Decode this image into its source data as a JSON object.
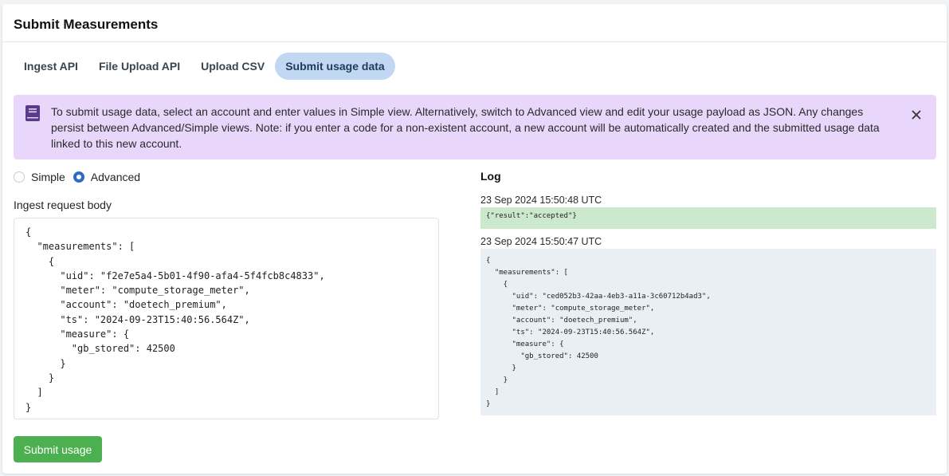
{
  "page": {
    "title": "Submit Measurements"
  },
  "tabs": [
    {
      "label": "Ingest API",
      "active": false
    },
    {
      "label": "File Upload API",
      "active": false
    },
    {
      "label": "Upload CSV",
      "active": false
    },
    {
      "label": "Submit usage data",
      "active": true
    }
  ],
  "banner": {
    "icon": "book-icon",
    "text": "To submit usage data, select an account and enter values in Simple view. Alternatively, switch to Advanced view and edit your usage payload as JSON. Any changes persist between Advanced/Simple views. Note: if you enter a code for a non-existent account, a new account will be automatically created and the submitted usage data linked to this new account.",
    "color": "#e8d7fb"
  },
  "view_toggle": {
    "options": [
      {
        "label": "Simple",
        "checked": false
      },
      {
        "label": "Advanced",
        "checked": true
      }
    ]
  },
  "editor": {
    "label": "Ingest request body",
    "content": "{\n  \"measurements\": [\n    {\n      \"uid\": \"f2e7e5a4-5b01-4f90-afa4-5f4fcb8c4833\",\n      \"meter\": \"compute_storage_meter\",\n      \"account\": \"doetech_premium\",\n      \"ts\": \"2024-09-23T15:40:56.564Z\",\n      \"measure\": {\n        \"gb_stored\": 42500\n      }\n    }\n  ]\n}"
  },
  "log": {
    "title": "Log",
    "entries": [
      {
        "timestamp": "23 Sep 2024 15:50:48 UTC",
        "content": "{\"result\":\"accepted\"}",
        "status_color": "#cde9cd"
      },
      {
        "timestamp": "23 Sep 2024 15:50:47 UTC",
        "content": "{\n  \"measurements\": [\n    {\n      \"uid\": \"ced052b3-42aa-4eb3-a11a-3c60712b4ad3\",\n      \"meter\": \"compute_storage_meter\",\n      \"account\": \"doetech_premium\",\n      \"ts\": \"2024-09-23T15:40:56.564Z\",\n      \"measure\": {\n        \"gb_stored\": 42500\n      }\n    }\n  ]\n}",
        "status_color": "#e9eff5"
      }
    ]
  },
  "actions": {
    "submit_label": "Submit usage"
  },
  "colors": {
    "accent": "#2f6bc4",
    "submit": "#4caf50",
    "tab_active": "#c2d8f2"
  }
}
